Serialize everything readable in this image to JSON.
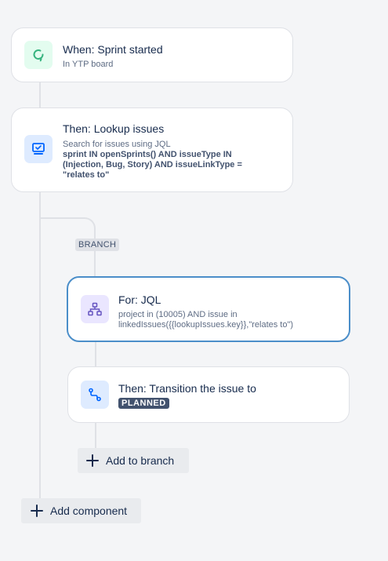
{
  "trigger": {
    "title": "When: Sprint started",
    "subtitle": "In YTP board",
    "icon": "refresh-icon",
    "color": "#36b37e"
  },
  "lookup": {
    "title": "Then: Lookup issues",
    "desc": "Search for issues using JQL",
    "jql_line1": "sprint IN openSprints() AND issueType IN",
    "jql_line2": "(Injection, Bug, Story) AND issueLinkType =",
    "jql_line3": "\"relates to\"",
    "icon": "monitor-check-icon",
    "color": "#0065ff"
  },
  "branch": {
    "label": "BRANCH"
  },
  "for_jql": {
    "title": "For: JQL",
    "line1": "project in (10005) AND issue in",
    "line2": "linkedIssues({{lookupIssues.key}},\"relates to\")",
    "icon": "hierarchy-icon",
    "color": "#6554c0"
  },
  "transition": {
    "title": "Then: Transition the issue to",
    "status": "PLANNED",
    "icon": "transition-path-icon",
    "color": "#0065ff"
  },
  "buttons": {
    "add_to_branch": "Add to branch",
    "add_component": "Add component"
  }
}
